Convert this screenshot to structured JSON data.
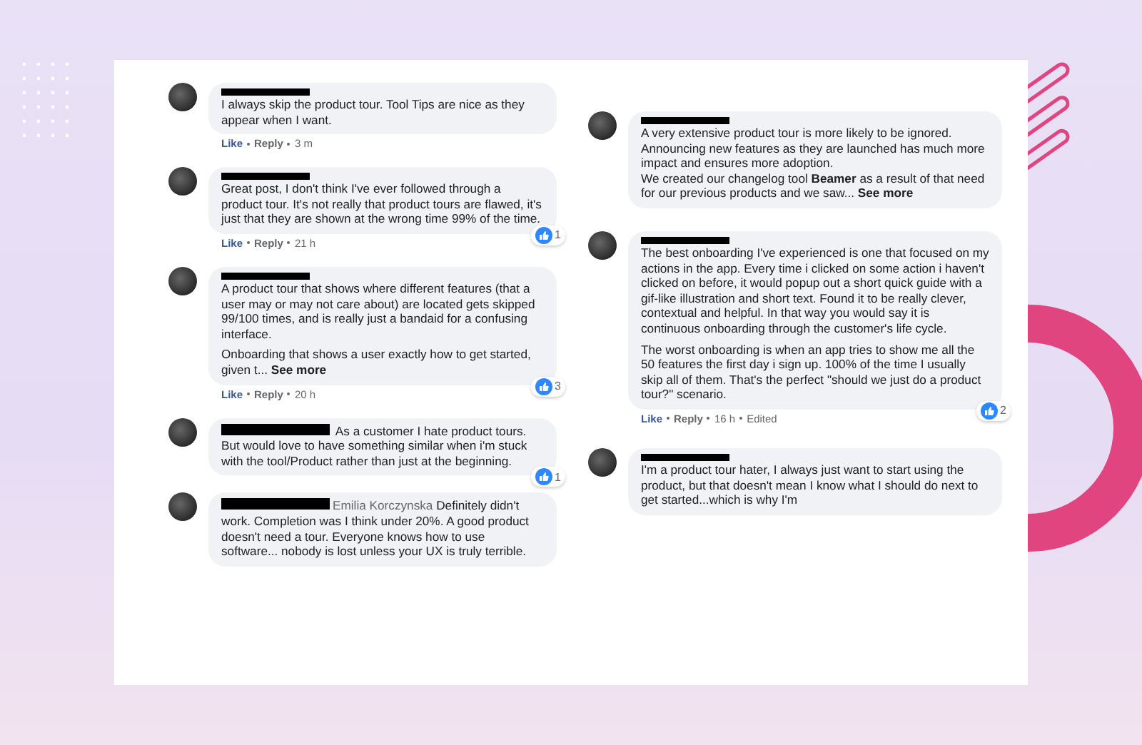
{
  "columns": [
    {
      "comments": [
        {
          "author_inline": false,
          "paragraphs": [
            "I always skip the product tour. Tool Tips are nice as they appear when I want."
          ],
          "actions": [
            "Like",
            "Reply",
            "3 m"
          ]
        },
        {
          "author_inline": false,
          "paragraphs": [
            "Great post, I don't think I've ever followed through a product tour. It's not really that product tours are flawed, it's just that they are shown at the wrong time 99% of the time."
          ],
          "actions": [
            "Like",
            "Reply",
            "21 h"
          ],
          "reactions": "1"
        },
        {
          "author_inline": false,
          "paragraphs": [
            "A product tour that shows where different features (that a user may or may not care about) are located gets skipped 99/100 times, and is really just a bandaid for a confusing interface.",
            "Onboarding that shows a user exactly how to get started, given t... **See more**"
          ],
          "actions": [
            "Like",
            "Reply",
            "20 h"
          ],
          "reactions": "3"
        },
        {
          "author_inline": true,
          "paragraphs": [
            "As a customer I hate product tours. But would love to have something similar when i'm stuck with the tool/Product rather than just at the beginning."
          ],
          "reactions": "1"
        },
        {
          "author_inline": true,
          "mention": "Emilia Korczynska",
          "paragraphs": [
            "Definitely didn't work. Completion was I think under 20%. A good product doesn't need a tour. Everyone knows how to use software... nobody is lost unless your UX is truly terrible."
          ]
        }
      ]
    },
    {
      "comments": [
        {
          "author_inline": false,
          "paragraphs": [
            "A very extensive product tour is more likely to be ignored.\nAnnouncing new features as they are launched has much more impact and ensures more adoption.\nWe created our changelog tool **Beamer** as a result of that need for our previous products and we saw... **See more**"
          ]
        },
        {
          "author_inline": false,
          "paragraphs": [
            "The best onboarding I've experienced is one that focused on my actions in the app. Every time i clicked on some action i haven't clicked on before, it would popup out a short quick guide with a gif-like illustration and short text. Found it to be really clever, contextual and helpful. In that way you would say it is continuous onboarding through the customer's life cycle.",
            "The worst onboarding is when an app tries to show me all the 50 features the first day i sign up. 100% of the time I usually skip all of them. That's the perfect \"should we just do a product tour?\" scenario."
          ],
          "actions": [
            "Like",
            "Reply",
            "16 h",
            "Edited"
          ],
          "reactions": "2"
        },
        {
          "author_inline": false,
          "paragraphs": [
            "I'm a product tour hater, I always just want to start using the product, but that doesn't mean I know what I should do next to get started...which is why I'm"
          ]
        }
      ]
    }
  ]
}
